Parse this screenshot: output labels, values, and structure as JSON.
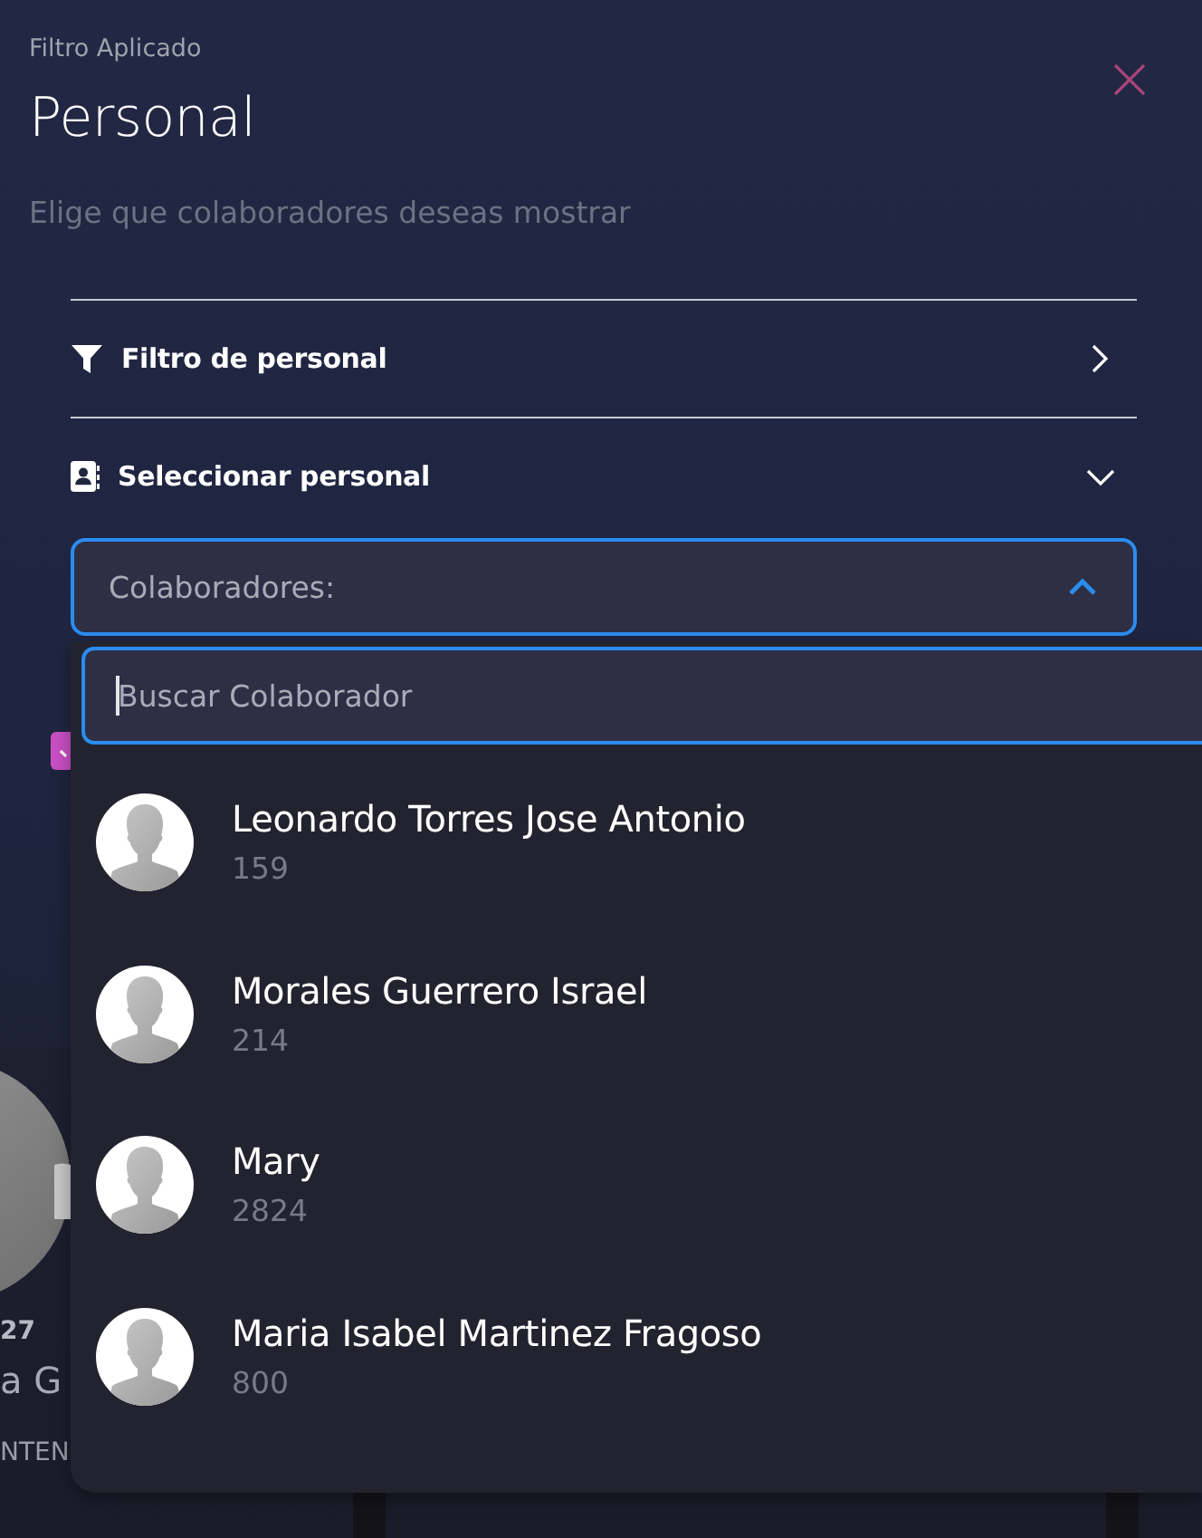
{
  "header": {
    "overline": "Filtro Aplicado",
    "title": "Personal",
    "subtitle": "Elige que colaboradores deseas mostrar"
  },
  "sections": [
    {
      "kind": "filter",
      "label": "Filtro de personal",
      "expanded": false
    },
    {
      "kind": "contacts",
      "label": "Seleccionar personal",
      "expanded": true
    }
  ],
  "select": {
    "label": "Colaboradores:",
    "open": true
  },
  "search": {
    "placeholder": "Buscar Colaborador",
    "focused": true
  },
  "options": [
    {
      "name": "Leonardo Torres Jose Antonio",
      "number": "159"
    },
    {
      "name": "Morales Guerrero Israel",
      "number": "214"
    },
    {
      "name": "Mary",
      "number": "2824"
    },
    {
      "name": "Maria Isabel Martinez Fragoso",
      "number": "800"
    }
  ],
  "background": {
    "checkbox": {
      "checked": true
    },
    "card": {
      "number": "27",
      "name": "a G",
      "tag": "NTEN"
    }
  }
}
